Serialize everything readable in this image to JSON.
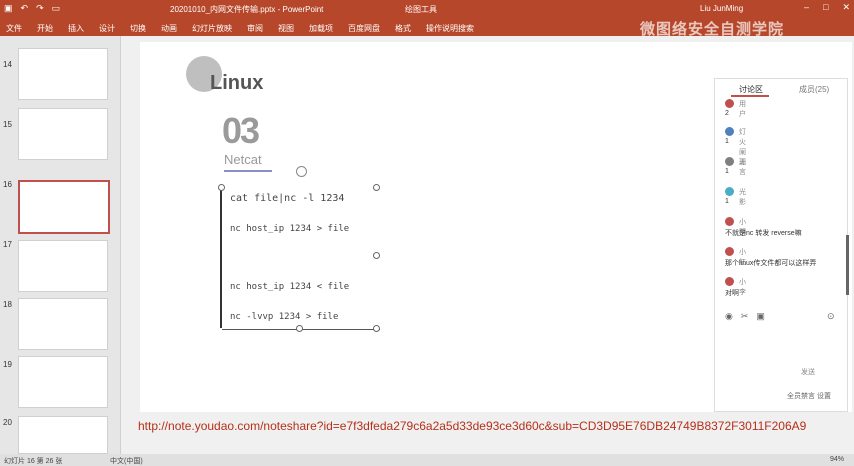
{
  "titlebar": {
    "title": "20201010_内网文件传输.pptx  -  PowerPoint",
    "center": "绘图工具",
    "user": "Liu JunMing"
  },
  "ribbon": {
    "tabs": [
      "文件",
      "开始",
      "插入",
      "设计",
      "切换",
      "动画",
      "幻灯片放映",
      "审阅",
      "视图",
      "加载项",
      "百度网盘",
      "格式",
      "操作说明搜索"
    ]
  },
  "watermark": "微图络安全自测学院",
  "thumbnails": [
    {
      "num": "14"
    },
    {
      "num": "15"
    },
    {
      "num": "16"
    },
    {
      "num": "17"
    },
    {
      "num": "18"
    },
    {
      "num": "19"
    },
    {
      "num": "20"
    }
  ],
  "slide": {
    "logo": "Linux",
    "number": "03",
    "subtitle": "Netcat",
    "code_lines": [
      "cat file|nc -l 1234",
      "nc host_ip 1234 > file",
      "nc host_ip 1234 < file",
      "nc -lvvp 1234 > file"
    ]
  },
  "chat": {
    "tab_discussion": "讨论区",
    "tab_members": "成员(25)",
    "messages": [
      {
        "name": "用户",
        "text": "2",
        "color": "#c0504d"
      },
      {
        "name": "灯火阑珊",
        "text": "1",
        "color": "#4f81bd"
      },
      {
        "name": "无言",
        "text": "1",
        "color": "#7f7f7f"
      },
      {
        "name": "光影",
        "text": "1",
        "color": "#4bacc6"
      },
      {
        "name": "小明",
        "text": "不就是nc 转发 reverse嘛",
        "color": "#c0504d"
      },
      {
        "name": "小红",
        "text": "那个linux传文件都可以这样弄",
        "color": "#c0504d"
      },
      {
        "name": "小李",
        "text": "对啊",
        "color": "#c0504d"
      }
    ],
    "send_label": "发送",
    "bottom_text": "全员禁言  设置"
  },
  "url": "http://note.youdao.com/noteshare?id=e7f3dfeda279c6a2a5d33de93ce3d60c&sub=CD3D95E76DB24749B8372F3011F206A9",
  "status": {
    "left": "幻灯片 16 第 26 张",
    "lang": "中文(中国)",
    "zoom": "94%"
  }
}
